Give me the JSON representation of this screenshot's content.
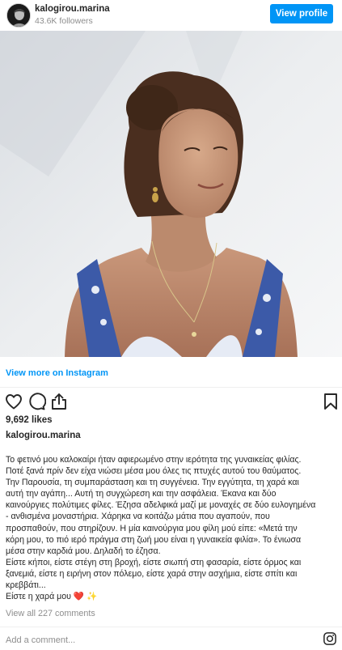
{
  "header": {
    "username": "kalogirou.marina",
    "followers": "43.6K followers",
    "view_profile_label": "View profile",
    "avatar_icon": "profile-avatar"
  },
  "post": {
    "photo_icon": "portrait-photo",
    "view_more_label": "View more on Instagram"
  },
  "actions": {
    "like_icon": "heart-icon",
    "comment_icon": "comment-icon",
    "share_icon": "share-icon",
    "save_icon": "bookmark-icon"
  },
  "likes": "9,692 likes",
  "caption": {
    "username": "kalogirou.marina",
    "lines": [
      "Το φετινό μου καλοκαίρι ήταν αφιερωμένο στην ιερότητα της γυναικείας φιλίας.",
      "Ποτέ ξανά πρίν δεν είχα νιώσει μέσα μου όλες τις πτυχές αυτού του θαύματος.",
      "Την Παρουσία, τη συμπαράσταση και τη συγγένεια. Την εγγύτητα, τη χαρά και",
      "αυτή την αγάπη... Αυτή τη συγχώρεση και την ασφάλεια. Έκανα και δύο",
      "καινούργιες πολύτιμες φίλες. Έζησα αδελφικά μαζί με μοναχές σε δύο ευλογημένα",
      "- ανθισμένα μοναστήρια. Χάρηκα να κοιτάζω μάτια που αγαπούν, που",
      "προσπαθούν, που στηρίζουν. Η μία καινούργια μου φίλη μού είπε: «Μετά την",
      "κόρη μου, το πιό ιερό πράγμα στη ζωή μου είναι η γυναικεία φιλία». Το ένιωσα",
      "μέσα στην καρδιά μου. Δηλαδή το έζησα.",
      "Είστε κήποι, είστε στέγη στη βροχή, είστε σιωπή στη φασαρία, είστε όρμος και",
      "ξανεμιά, είστε η ειρήνη στον πόλεμο, είστε χαρά στην ασχήμια, είστε σπίτι και",
      "κρεββάτι..."
    ],
    "last_line": "Είστε η χαρά μου",
    "emoji_heart": "❤️",
    "emoji_sparkles": "✨"
  },
  "view_all_comments": "View all 227 comments",
  "comment_bar": {
    "placeholder": "Add a comment...",
    "instagram_icon": "instagram-logo"
  }
}
